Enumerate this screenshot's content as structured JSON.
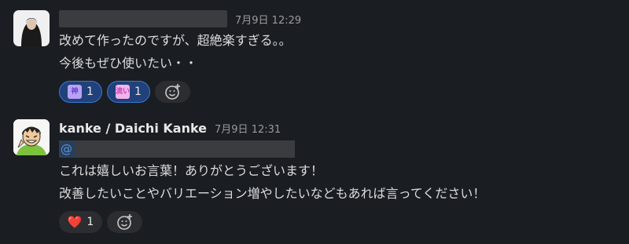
{
  "messages": [
    {
      "author": "",
      "timestamp": "7月9日 12:29",
      "lines": [
        "改めて作ったのですが、超絶楽すぎる。。",
        "今後もぜひ使いたい・・"
      ],
      "reactions": [
        {
          "emoji": "神",
          "count": "1",
          "color": "#6a3fd6"
        },
        {
          "emoji": "流い",
          "count": "1",
          "color": "#c33fb7"
        }
      ]
    },
    {
      "author": "kanke / Daichi Kanke",
      "timestamp": "7月9日 12:31",
      "mention_prefix": "@",
      "lines": [
        "これは嬉しいお言葉！ありがとうございます！",
        "改善したいことやバリエーション増やしたいなどもあれば言ってください！"
      ],
      "reactions": [
        {
          "emoji": "❤️",
          "count": "1",
          "color": "#e03a3a"
        }
      ]
    }
  ],
  "icons": {
    "add_reaction": "add-reaction-icon"
  }
}
